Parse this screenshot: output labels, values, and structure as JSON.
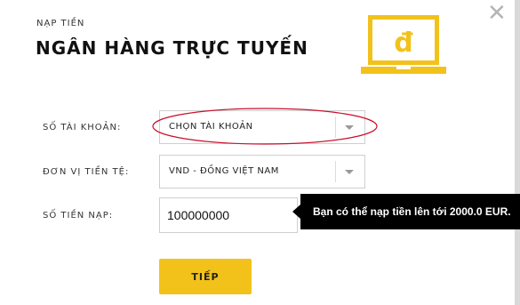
{
  "dialog": {
    "subtitle": "NẠP TIỀN",
    "title": "NGÂN HÀNG TRỰC TUYẾN",
    "close_icon": "close-icon",
    "illustration_icon": "laptop-dong-icon",
    "illustration_symbol": "đ"
  },
  "form": {
    "account_label": "SỐ TÀI KHOẢN:",
    "account_value": "CHỌN TÀI KHOẢN",
    "currency_label": "ĐƠN VỊ TIỀN TỆ:",
    "currency_value": "VND - ĐỒNG VIỆT NAM",
    "amount_label": "SỐ TIỀN NẠP:",
    "amount_value": "100000000",
    "amount_tooltip": "Bạn có thể nạp tiền lên tới 2000.0 EUR.",
    "submit_label": "TIẾP"
  },
  "colors": {
    "accent": "#f2c21b",
    "annotation": "#c8102e"
  }
}
